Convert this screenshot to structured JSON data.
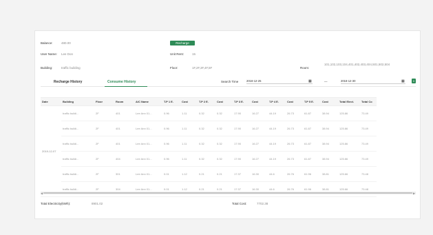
{
  "info": {
    "balance_label": "Balance:",
    "balance_value": "480.00",
    "recharge_label": "Recharge",
    "username_label": "User Name:",
    "username_value": "Lee Don",
    "unit_rent_label": "Unit Rent:",
    "unit_rent_value": "15",
    "building_label": "Building:",
    "building_value": "traffic building",
    "floor_label": "Floor:",
    "floor_value": "1F,2F,3F,4F,5F",
    "room_label": "Room:",
    "room_value": "101,102,103,104,401,402,403,404,501,502,504"
  },
  "tabs": {
    "recharge": "Recharge History",
    "consume": "Consume History"
  },
  "filter": {
    "label": "Search Time",
    "start": "2018-12-25",
    "sep": "—",
    "end": "2018-12-30",
    "cal_icon": "calendar-icon",
    "export_icon": "excel-export-icon"
  },
  "table": {
    "headers": [
      "Date",
      "Building",
      "Floor",
      "Room",
      "A/C Name",
      "T.P 1 E.",
      "Cost",
      "T.P 2 E.",
      "Cost",
      "T.P 3 E.",
      "Cost",
      "T.P 4 E.",
      "Cost",
      "T.P 5 E.",
      "Cost",
      "Total Elect.",
      "Total Co"
    ],
    "date": "2019-12-07",
    "rows": [
      [
        "traffic buildi...",
        "2F",
        "401",
        "Lee Ann 01...",
        "0.96",
        "1.11",
        "0.32",
        "0.32",
        "17.90",
        "16.27",
        "44.19",
        "26.73",
        "61.87",
        "38.94",
        "125.86",
        "73.49"
      ],
      [
        "traffic buildi...",
        "2F",
        "401",
        "Lee Ann 01...",
        "0.96",
        "1.11",
        "0.32",
        "0.32",
        "17.90",
        "16.27",
        "44.19",
        "26.73",
        "61.87",
        "38.94",
        "125.86",
        "73.49"
      ],
      [
        "traffic buildi...",
        "2F",
        "401",
        "Lee Ann 01...",
        "0.96",
        "1.11",
        "0.32",
        "0.32",
        "17.90",
        "16.27",
        "44.19",
        "26.73",
        "61.87",
        "38.94",
        "125.86",
        "73.49"
      ],
      [
        "traffic buildi...",
        "2F",
        "404",
        "Lee Ann 01...",
        "0.96",
        "1.11",
        "0.32",
        "0.32",
        "17.90",
        "16.27",
        "44.19",
        "26.73",
        "61.87",
        "38.94",
        "125.86",
        "73.49"
      ],
      [
        "traffic buildi...",
        "2F",
        "301",
        "Lee Ann 01...",
        "0.01",
        "1.12",
        "0.21",
        "0.21",
        "17.37",
        "16.30",
        "44.6",
        "26.76",
        "61.96",
        "38.81",
        "125.66",
        "73.48"
      ],
      [
        "traffic buildi...",
        "2F",
        "304",
        "Lee Ann 01...",
        "0.01",
        "1.12",
        "0.21",
        "0.21",
        "17.37",
        "16.30",
        "44.6",
        "26.76",
        "61.96",
        "38.81",
        "125.66",
        "73.48"
      ]
    ]
  },
  "footer": {
    "total_elec_label": "Total Electricity(kWh):",
    "total_elec_value": "8901.02",
    "total_cost_label": "Total Cost:",
    "total_cost_value": "7702.38"
  }
}
